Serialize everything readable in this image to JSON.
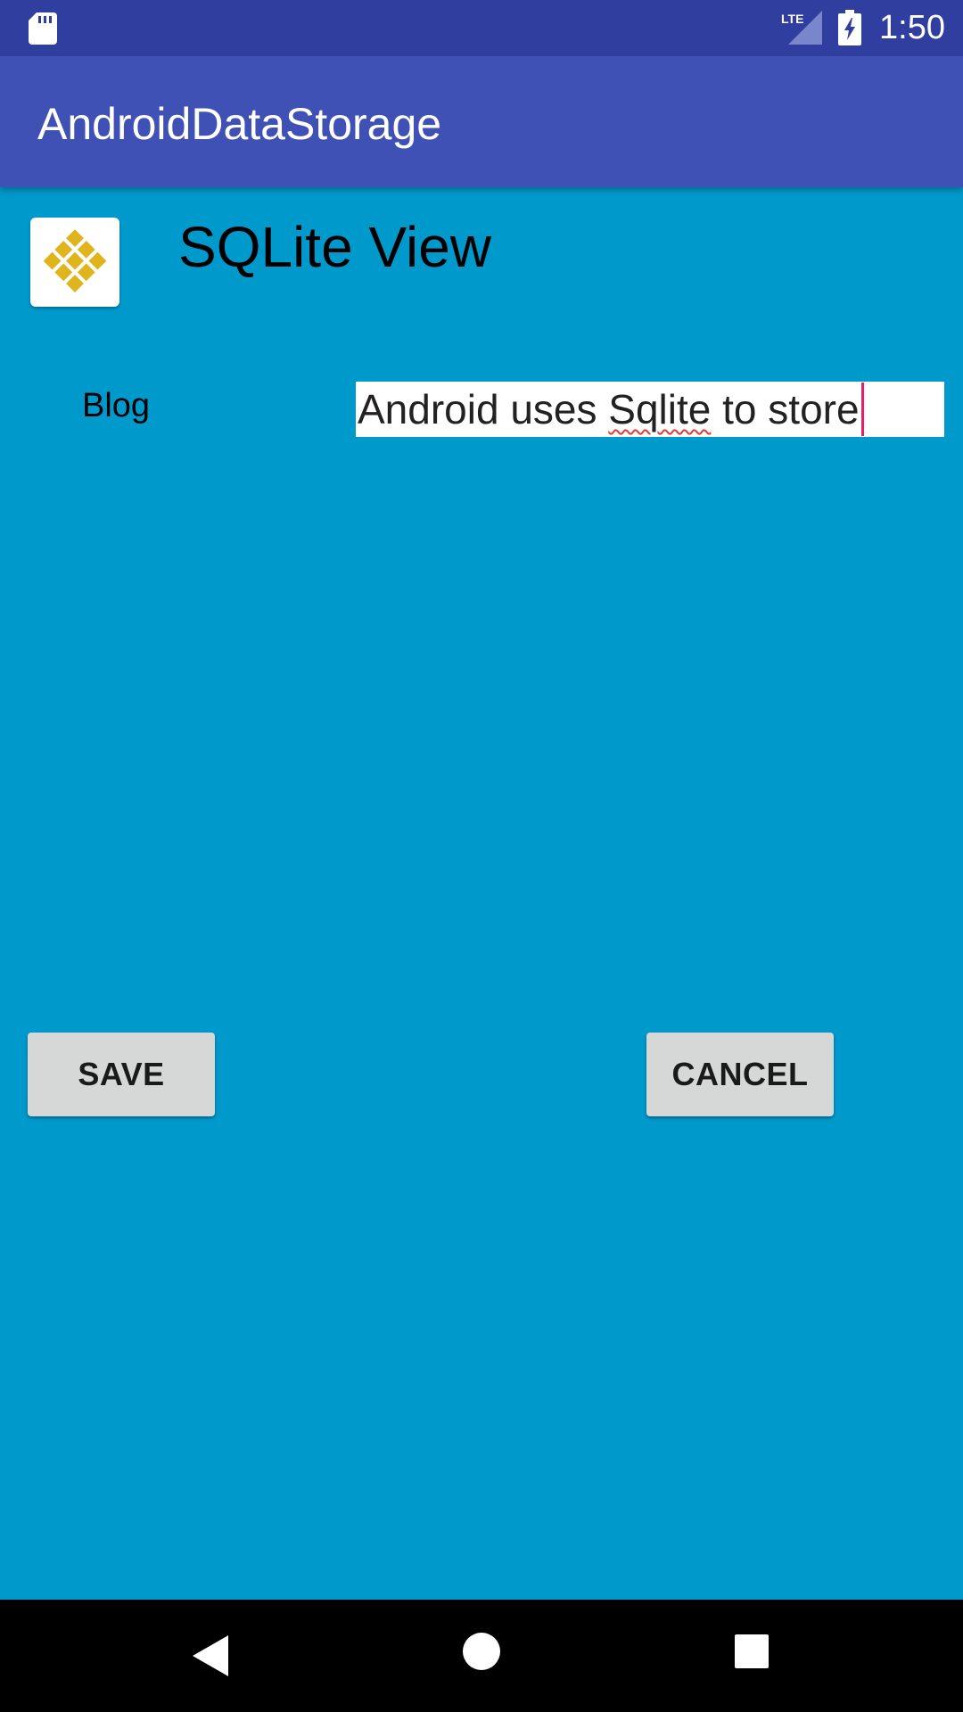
{
  "status_bar": {
    "time": "1:50",
    "network_label": "LTE",
    "icons": [
      "sd-card-icon",
      "lte-signal-icon",
      "battery-charging-icon"
    ]
  },
  "app_bar": {
    "title": "AndroidDataStorage"
  },
  "header": {
    "icon": "sqlite-app-icon",
    "title": "SQLite View"
  },
  "form": {
    "blog_label": "Blog",
    "blog_value_before": "Android uses ",
    "blog_value_misspelled": "Sqlite",
    "blog_value_after": " to store"
  },
  "actions": {
    "save_label": "SAVE",
    "cancel_label": "CANCEL"
  },
  "nav_bar": {
    "icons": [
      "back-icon",
      "home-icon",
      "recents-icon"
    ]
  },
  "colors": {
    "status_bar": "#303F9F",
    "app_bar": "#3F51B5",
    "background": "#0099CC",
    "button": "#D6D7D7",
    "cursor": "#E91E63",
    "spellcheck": "#E53935",
    "app_icon_accent": "#E0B41C"
  }
}
